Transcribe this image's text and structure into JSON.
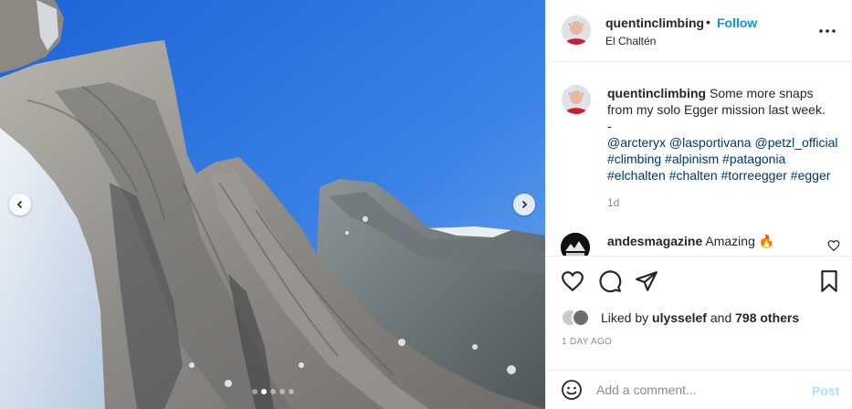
{
  "photo": {
    "description_icon": "mountain-photo",
    "carousel_dots": 5,
    "active_dot": 1
  },
  "header": {
    "username": "quentinclimbing",
    "bullet": "•",
    "follow_label": "Follow",
    "location": "El Chaltén"
  },
  "caption": {
    "username": "quentinclimbing",
    "text": " Some more snaps from my solo Egger mission last week.",
    "separator": "-",
    "mentions": "@arcteryx @lasportivana @petzl_official",
    "hashtags": "#climbing #alpinism #patagonia #elchalten #chalten #torreegger #egger",
    "age": "1d"
  },
  "comment": {
    "username": "andesmagazine",
    "text": " Amazing ",
    "emoji": "🔥"
  },
  "likes": {
    "prefix": "Liked by ",
    "user": "ulysselef",
    "middle": " and ",
    "others": "798 others"
  },
  "timestamp": "1 DAY AGO",
  "add_comment": {
    "placeholder": "Add a comment...",
    "post_label": "Post"
  },
  "colors": {
    "accent": "#0095f6",
    "link": "#00376b",
    "muted": "#8e8e8e",
    "post_disabled": "#b2dffc"
  }
}
